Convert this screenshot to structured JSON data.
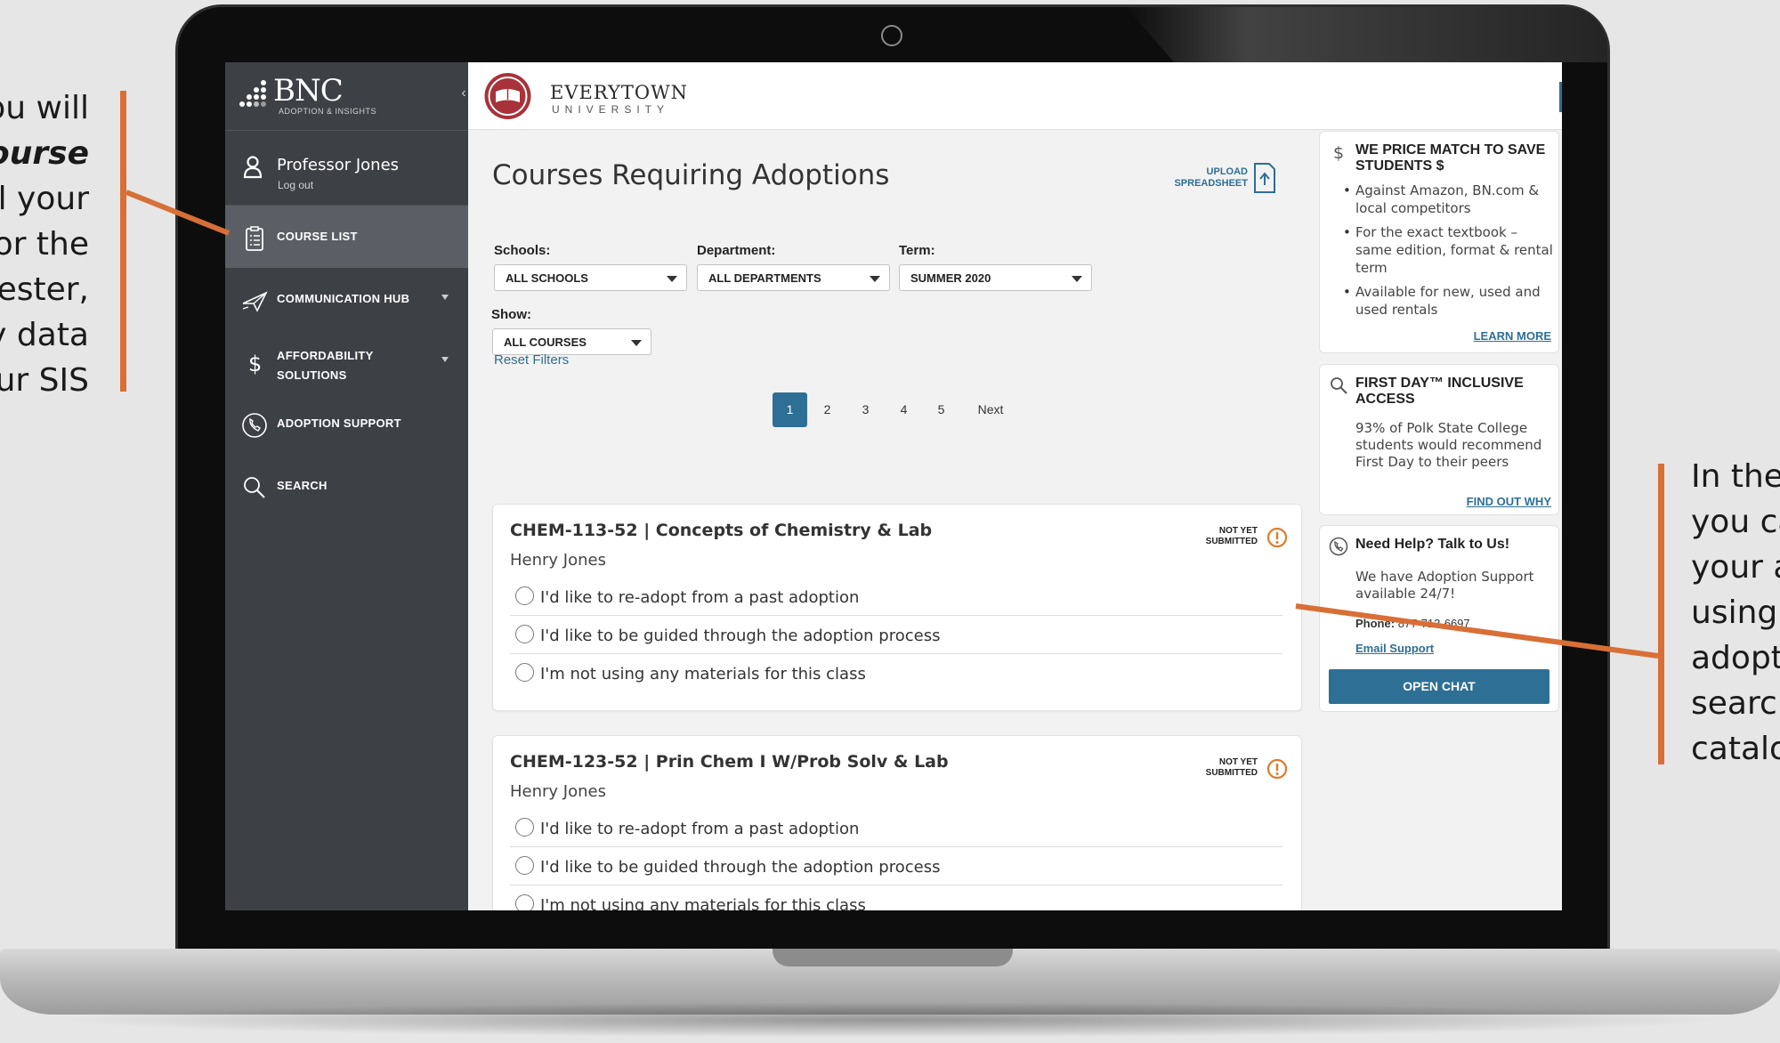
{
  "callouts": {
    "left_lines": [
      "you will",
      "Course",
      "ll your",
      "or the",
      "nester,",
      "y data",
      "our SIS"
    ],
    "right_lines": [
      "In the",
      "you ca",
      "your a",
      "using",
      "adopt",
      "search",
      "catalo"
    ]
  },
  "sidebar": {
    "brand_name": "BNC",
    "brand_tag": "ADOPTION & INSIGHTS",
    "collapse_glyph": "‹",
    "user_name": "Professor Jones",
    "logout": "Log out",
    "items": [
      {
        "label": "COURSE LIST",
        "icon": "clipboard-list-icon"
      },
      {
        "label": "COMMUNICATION HUB",
        "icon": "paper-plane-icon"
      },
      {
        "label": "AFFORDABILITY SOLUTIONS",
        "icon": "dollar-icon"
      },
      {
        "label": "ADOPTION SUPPORT",
        "icon": "phone-icon"
      },
      {
        "label": "SEARCH",
        "icon": "search-icon"
      }
    ]
  },
  "topbar": {
    "uni_name": "EVERYTOWN",
    "uni_sub": "UNIVERSITY"
  },
  "main": {
    "title": "Courses Requiring Adoptions",
    "upload_line1": "UPLOAD",
    "upload_line2": "SPREADSHEET",
    "filters": {
      "schools_label": "Schools:",
      "schools_value": "ALL SCHOOLS",
      "department_label": "Department:",
      "department_value": "ALL DEPARTMENTS",
      "term_label": "Term:",
      "term_value": "SUMMER 2020",
      "show_label": "Show:",
      "show_value": "ALL COURSES",
      "reset": "Reset Filters"
    },
    "pager": {
      "pages": [
        "1",
        "2",
        "3",
        "4",
        "5"
      ],
      "current": "1",
      "next": "Next"
    },
    "courses": [
      {
        "title": "CHEM-113-52 | Concepts of Chemistry & Lab",
        "instructor": "Henry Jones",
        "status_line1": "NOT YET",
        "status_line2": "SUBMITTED",
        "options": [
          "I'd like to re-adopt from a past adoption",
          "I'd like to be guided through the adoption process",
          "I'm not using any materials for this class"
        ]
      },
      {
        "title": "CHEM-123-52 | Prin Chem I W/Prob Solv & Lab",
        "instructor": "Henry Jones",
        "status_line1": "NOT YET",
        "status_line2": "SUBMITTED",
        "options": [
          "I'd like to re-adopt from a past adoption",
          "I'd like to be guided through the adoption process",
          "I'm not using any materials for this class"
        ]
      }
    ]
  },
  "right": {
    "price_match": {
      "heading": "WE PRICE MATCH TO SAVE STUDENTS $",
      "bullets": [
        "Against Amazon, BN.com & local competitors",
        "For the exact textbook – same edition, format & rental term",
        "Available for new, used and used rentals"
      ],
      "link": "LEARN MORE"
    },
    "first_day": {
      "heading": "FIRST DAY™ INCLUSIVE ACCESS",
      "text": "93% of Polk State College students would recommend First Day to their peers",
      "link": "FIND OUT WHY"
    },
    "help": {
      "heading": "Need Help? Talk to Us!",
      "text": "We have Adoption Support available 24/7!",
      "phone_label": "Phone:",
      "phone": "877-713-6697",
      "email": "Email Support",
      "chat": "OPEN CHAT"
    }
  },
  "colors": {
    "accent": "#2e6f95",
    "callout": "#d86f37",
    "warn": "#e07b2a",
    "sidebar": "#3d4045"
  }
}
